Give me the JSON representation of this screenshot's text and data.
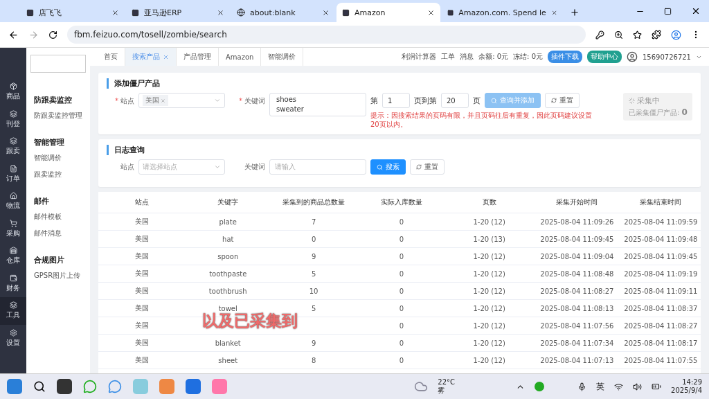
{
  "browser": {
    "tabs": [
      {
        "title": "店飞飞",
        "selected": false
      },
      {
        "title": "亚马逊ERP",
        "selected": false
      },
      {
        "title": "about:blank",
        "selected": false
      },
      {
        "title": "Amazon",
        "selected": true
      },
      {
        "title": "Amazon.com. Spend le",
        "selected": false
      }
    ],
    "url": "fbm.feizuo.com/tosell/zombie/search"
  },
  "rail": [
    {
      "label": "商品",
      "selected": false
    },
    {
      "label": "刊登",
      "selected": false
    },
    {
      "label": "跟卖",
      "selected": false
    },
    {
      "label": "订单",
      "selected": false
    },
    {
      "label": "物流",
      "selected": false
    },
    {
      "label": "采购",
      "selected": false
    },
    {
      "label": "仓库",
      "selected": false
    },
    {
      "label": "财务",
      "selected": false
    },
    {
      "label": "工具",
      "selected": true
    },
    {
      "label": "设置",
      "selected": false
    }
  ],
  "menu": [
    {
      "title": "防跟卖监控",
      "items": [
        "防跟卖监控管理"
      ]
    },
    {
      "title": "智能管理",
      "items": [
        "智能调价",
        "跟卖监控"
      ]
    },
    {
      "title": "邮件",
      "items": [
        "邮件模板",
        "邮件消息"
      ]
    },
    {
      "title": "合规图片",
      "items": [
        "GPSR图片上传"
      ]
    }
  ],
  "page_tabs": [
    {
      "label": "首页",
      "selected": false,
      "closable": false
    },
    {
      "label": "搜索产品",
      "selected": true,
      "closable": true
    },
    {
      "label": "产品管理",
      "selected": false,
      "closable": false
    },
    {
      "label": "Amazon",
      "selected": false,
      "closable": false
    },
    {
      "label": "智能调价",
      "selected": false,
      "closable": false
    }
  ],
  "header": {
    "links": [
      "利润计算器",
      "工单",
      "消息",
      "余额: 0元",
      "冻结: 0元"
    ],
    "plugin_button": "插件下载",
    "help_button": "帮助中心",
    "user": "15690726721"
  },
  "add_card": {
    "title": "添加僵尸产品",
    "required_mark": "*",
    "site_label": "站点",
    "site_tag": "美国",
    "keyword_label": "关键词",
    "keywords": "shoes\nsweater",
    "page_from_label": "第",
    "page_from": "1",
    "page_to_label": "页到第",
    "page_to": "20",
    "page_suffix": "页",
    "query_button": "查询并添加",
    "reset_button": "重置",
    "hint": "提示：因搜索结果的页码有限，并且页码往后有重复，因此页码建议设置20页以内。",
    "status": "采集中",
    "collected_label": "已采集僵尸产品:",
    "collected": "0"
  },
  "log_card": {
    "title": "日志查询",
    "site_label": "站点",
    "site_placeholder": "请选择站点",
    "keyword_label": "关键词",
    "keyword_placeholder": "请输入",
    "search_button": "搜索",
    "reset_button": "重置"
  },
  "table": {
    "columns": [
      "站点",
      "关键字",
      "采集到的商品总数量",
      "实际入库数量",
      "页数",
      "采集开始时间",
      "采集结束时间"
    ],
    "rows": [
      [
        "美国",
        "plate",
        "7",
        "0",
        "1-20 (12)",
        "2025-08-04 11:09:26",
        "2025-08-04 11:09:59"
      ],
      [
        "美国",
        "hat",
        "0",
        "0",
        "1-20 (13)",
        "2025-08-04 11:09:45",
        "2025-08-04 11:09:48"
      ],
      [
        "美国",
        "spoon",
        "9",
        "0",
        "1-20 (12)",
        "2025-08-04 11:09:04",
        "2025-08-04 11:09:45"
      ],
      [
        "美国",
        "toothpaste",
        "5",
        "0",
        "1-20 (12)",
        "2025-08-04 11:08:48",
        "2025-08-04 11:09:19"
      ],
      [
        "美国",
        "toothbrush",
        "10",
        "0",
        "1-20 (12)",
        "2025-08-04 11:08:27",
        "2025-08-04 11:09:11"
      ],
      [
        "美国",
        "towel",
        "5",
        "0",
        "1-20 (12)",
        "2025-08-04 11:08:13",
        "2025-08-04 11:08:37"
      ],
      [
        "美国",
        null,
        null,
        "0",
        "1-20 (12)",
        "2025-08-04 11:07:56",
        "2025-08-04 11:08:27"
      ],
      [
        "美国",
        "blanket",
        "9",
        "0",
        "1-20 (12)",
        "2025-08-04 11:07:34",
        "2025-08-04 11:08:17"
      ],
      [
        "美国",
        "sheet",
        "8",
        "0",
        "1-20 (12)",
        "2025-08-04 11:07:13",
        "2025-08-04 11:07:55"
      ]
    ]
  },
  "caption": "以及已采集到",
  "taskbar": {
    "weather_temp": "22°C",
    "weather_text": "雾",
    "ime": "英",
    "time": "14:29",
    "date": "2025/9/4"
  }
}
